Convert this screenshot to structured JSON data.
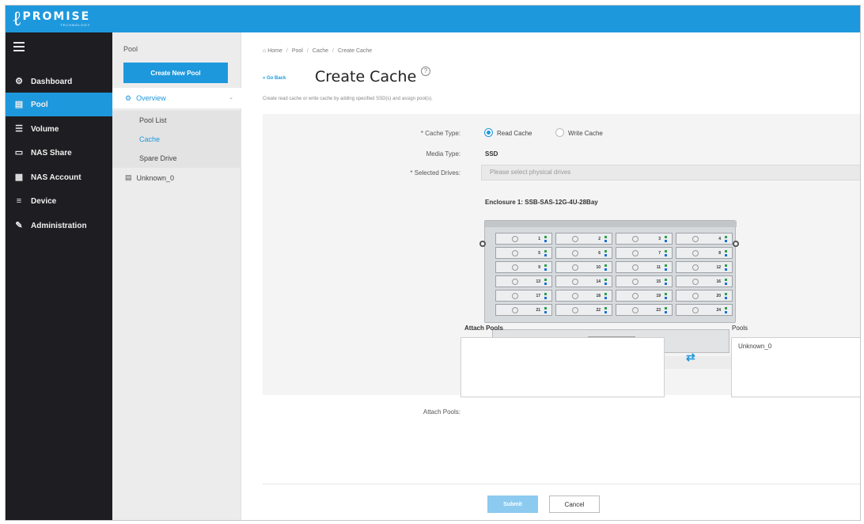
{
  "brand": {
    "name": "PROMISE",
    "sub": "TECHNOLOGY"
  },
  "sidebar": {
    "items": [
      {
        "label": "Dashboard",
        "icon": "dashboard-icon"
      },
      {
        "label": "Pool",
        "icon": "pool-icon",
        "active": true
      },
      {
        "label": "Volume",
        "icon": "volume-icon"
      },
      {
        "label": "NAS Share",
        "icon": "folder-icon"
      },
      {
        "label": "NAS Account",
        "icon": "account-icon"
      },
      {
        "label": "Device",
        "icon": "device-icon"
      },
      {
        "label": "Administration",
        "icon": "wrench-icon"
      }
    ]
  },
  "subnav": {
    "title": "Pool",
    "create_button": "Create New Pool",
    "overview": "Overview",
    "items": [
      "Pool List",
      "Cache",
      "Spare Drive"
    ],
    "current": "Cache",
    "pool_entry": "Unknown_0"
  },
  "breadcrumb": [
    "Home",
    "Pool",
    "Cache",
    "Create Cache"
  ],
  "page": {
    "go_back": "« Go Back",
    "title": "Create Cache",
    "help": "?",
    "description": "Create read cache or write cache by adding specified SSD(s) and assign pool(s)."
  },
  "form": {
    "cache_type_label": "* Cache Type:",
    "cache_types": [
      "Read Cache",
      "Write Cache"
    ],
    "selected_cache_type": "Read Cache",
    "media_type_label": "Media Type:",
    "media_type_value": "SSD",
    "drives_label": "* Selected Drives:",
    "drives_placeholder": "Please select physical drives",
    "enclosure_title": "Enclosure 1: SSB-SAS-12G-4U-28Bay",
    "bays": [
      "1",
      "2",
      "3",
      "4",
      "5",
      "6",
      "7",
      "8",
      "9",
      "10",
      "11",
      "12",
      "13",
      "14",
      "15",
      "16",
      "17",
      "18",
      "19",
      "20",
      "21",
      "22",
      "23",
      "24"
    ],
    "attach_label": "Attach Pools:",
    "attach_left_title": "Attach Pools",
    "attach_right_title": "Pools",
    "pools": [
      "Unknown_0"
    ]
  },
  "buttons": {
    "submit": "Submit",
    "cancel": "Cancel"
  },
  "colors": {
    "accent": "#1e98dd",
    "sidebar": "#1e1e22",
    "subnav": "#ececec"
  }
}
